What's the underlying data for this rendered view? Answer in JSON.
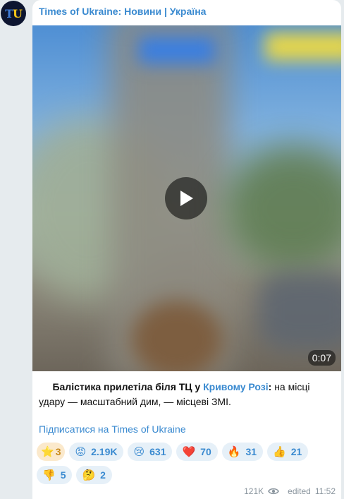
{
  "avatar": {
    "letter1": "T",
    "letter2": "U"
  },
  "channel": {
    "title": "Times of Ukraine: Новини | Україна"
  },
  "video": {
    "duration": "0:07"
  },
  "post": {
    "text_bold_1": "Балістика прилетіла біля ТЦ у ",
    "link": "Кривому Розі",
    "text_bold_2": ":",
    "text_rest": " на місці удару — масштабний дим, — місцеві ЗМІ."
  },
  "subscribe": {
    "label": "Підписатися на Times of Ukraine"
  },
  "reactions": [
    {
      "emoji": "⭐",
      "count": "3",
      "name": "star"
    },
    {
      "emoji": "😡",
      "count": "2.19K",
      "name": "angry"
    },
    {
      "emoji": "😢",
      "count": "631",
      "name": "crying"
    },
    {
      "emoji": "❤️",
      "count": "70",
      "name": "heart"
    },
    {
      "emoji": "🔥",
      "count": "31",
      "name": "fire"
    },
    {
      "emoji": "👍",
      "count": "21",
      "name": "thumbs-up"
    },
    {
      "emoji": "👎",
      "count": "5",
      "name": "thumbs-down"
    },
    {
      "emoji": "🤔",
      "count": "2",
      "name": "thinking"
    }
  ],
  "footer": {
    "views": "121K",
    "edited": "edited",
    "time": "11:52"
  },
  "colors": {
    "accent": "#3a8ad0",
    "background": "#e6ebee",
    "bubble": "#ffffff"
  }
}
